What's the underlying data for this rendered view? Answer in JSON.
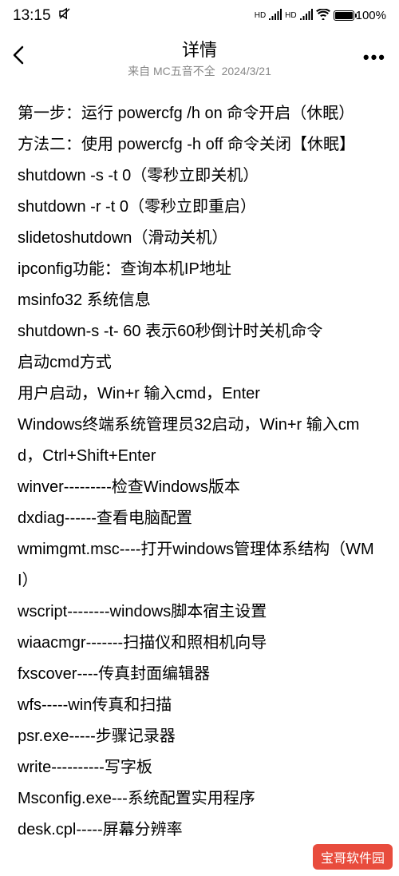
{
  "status_bar": {
    "time": "13:15",
    "hd1": "HD",
    "hd2": "HD",
    "battery_percent": "100%"
  },
  "header": {
    "title": "详情",
    "subtitle_prefix": "来自",
    "author": "MC五音不全",
    "date": "2024/3/21"
  },
  "content": {
    "lines": [
      "第一步：运行 powercfg /h on 命令开启（休眠）",
      "方法二：使用 powercfg -h off 命令关闭【休眠】",
      "shutdown -s -t 0（零秒立即关机）",
      "shutdown -r -t 0（零秒立即重启）",
      "slidetoshutdown（滑动关机）",
      "ipconfig功能：查询本机IP地址",
      "msinfo32 系统信息",
      "shutdown-s -t- 60 表示60秒倒计时关机命令",
      "启动cmd方式",
      "用户启动，Win+r 输入cmd，Enter",
      "Windows终端系统管理员32启动，Win+r 输入cmd，Ctrl+Shift+Enter",
      "winver---------检查Windows版本",
      "dxdiag------查看电脑配置",
      "wmimgmt.msc----打开windows管理体系结构（WMI）",
      "wscript--------windows脚本宿主设置",
      "wiaacmgr-------扫描仪和照相机向导",
      "fxscover----传真封面编辑器",
      "wfs-----win传真和扫描",
      "psr.exe-----步骤记录器",
      "write----------写字板",
      "Msconfig.exe---系统配置实用程序",
      "desk.cpl-----屏幕分辨率"
    ]
  },
  "watermark": "宝哥软件园"
}
